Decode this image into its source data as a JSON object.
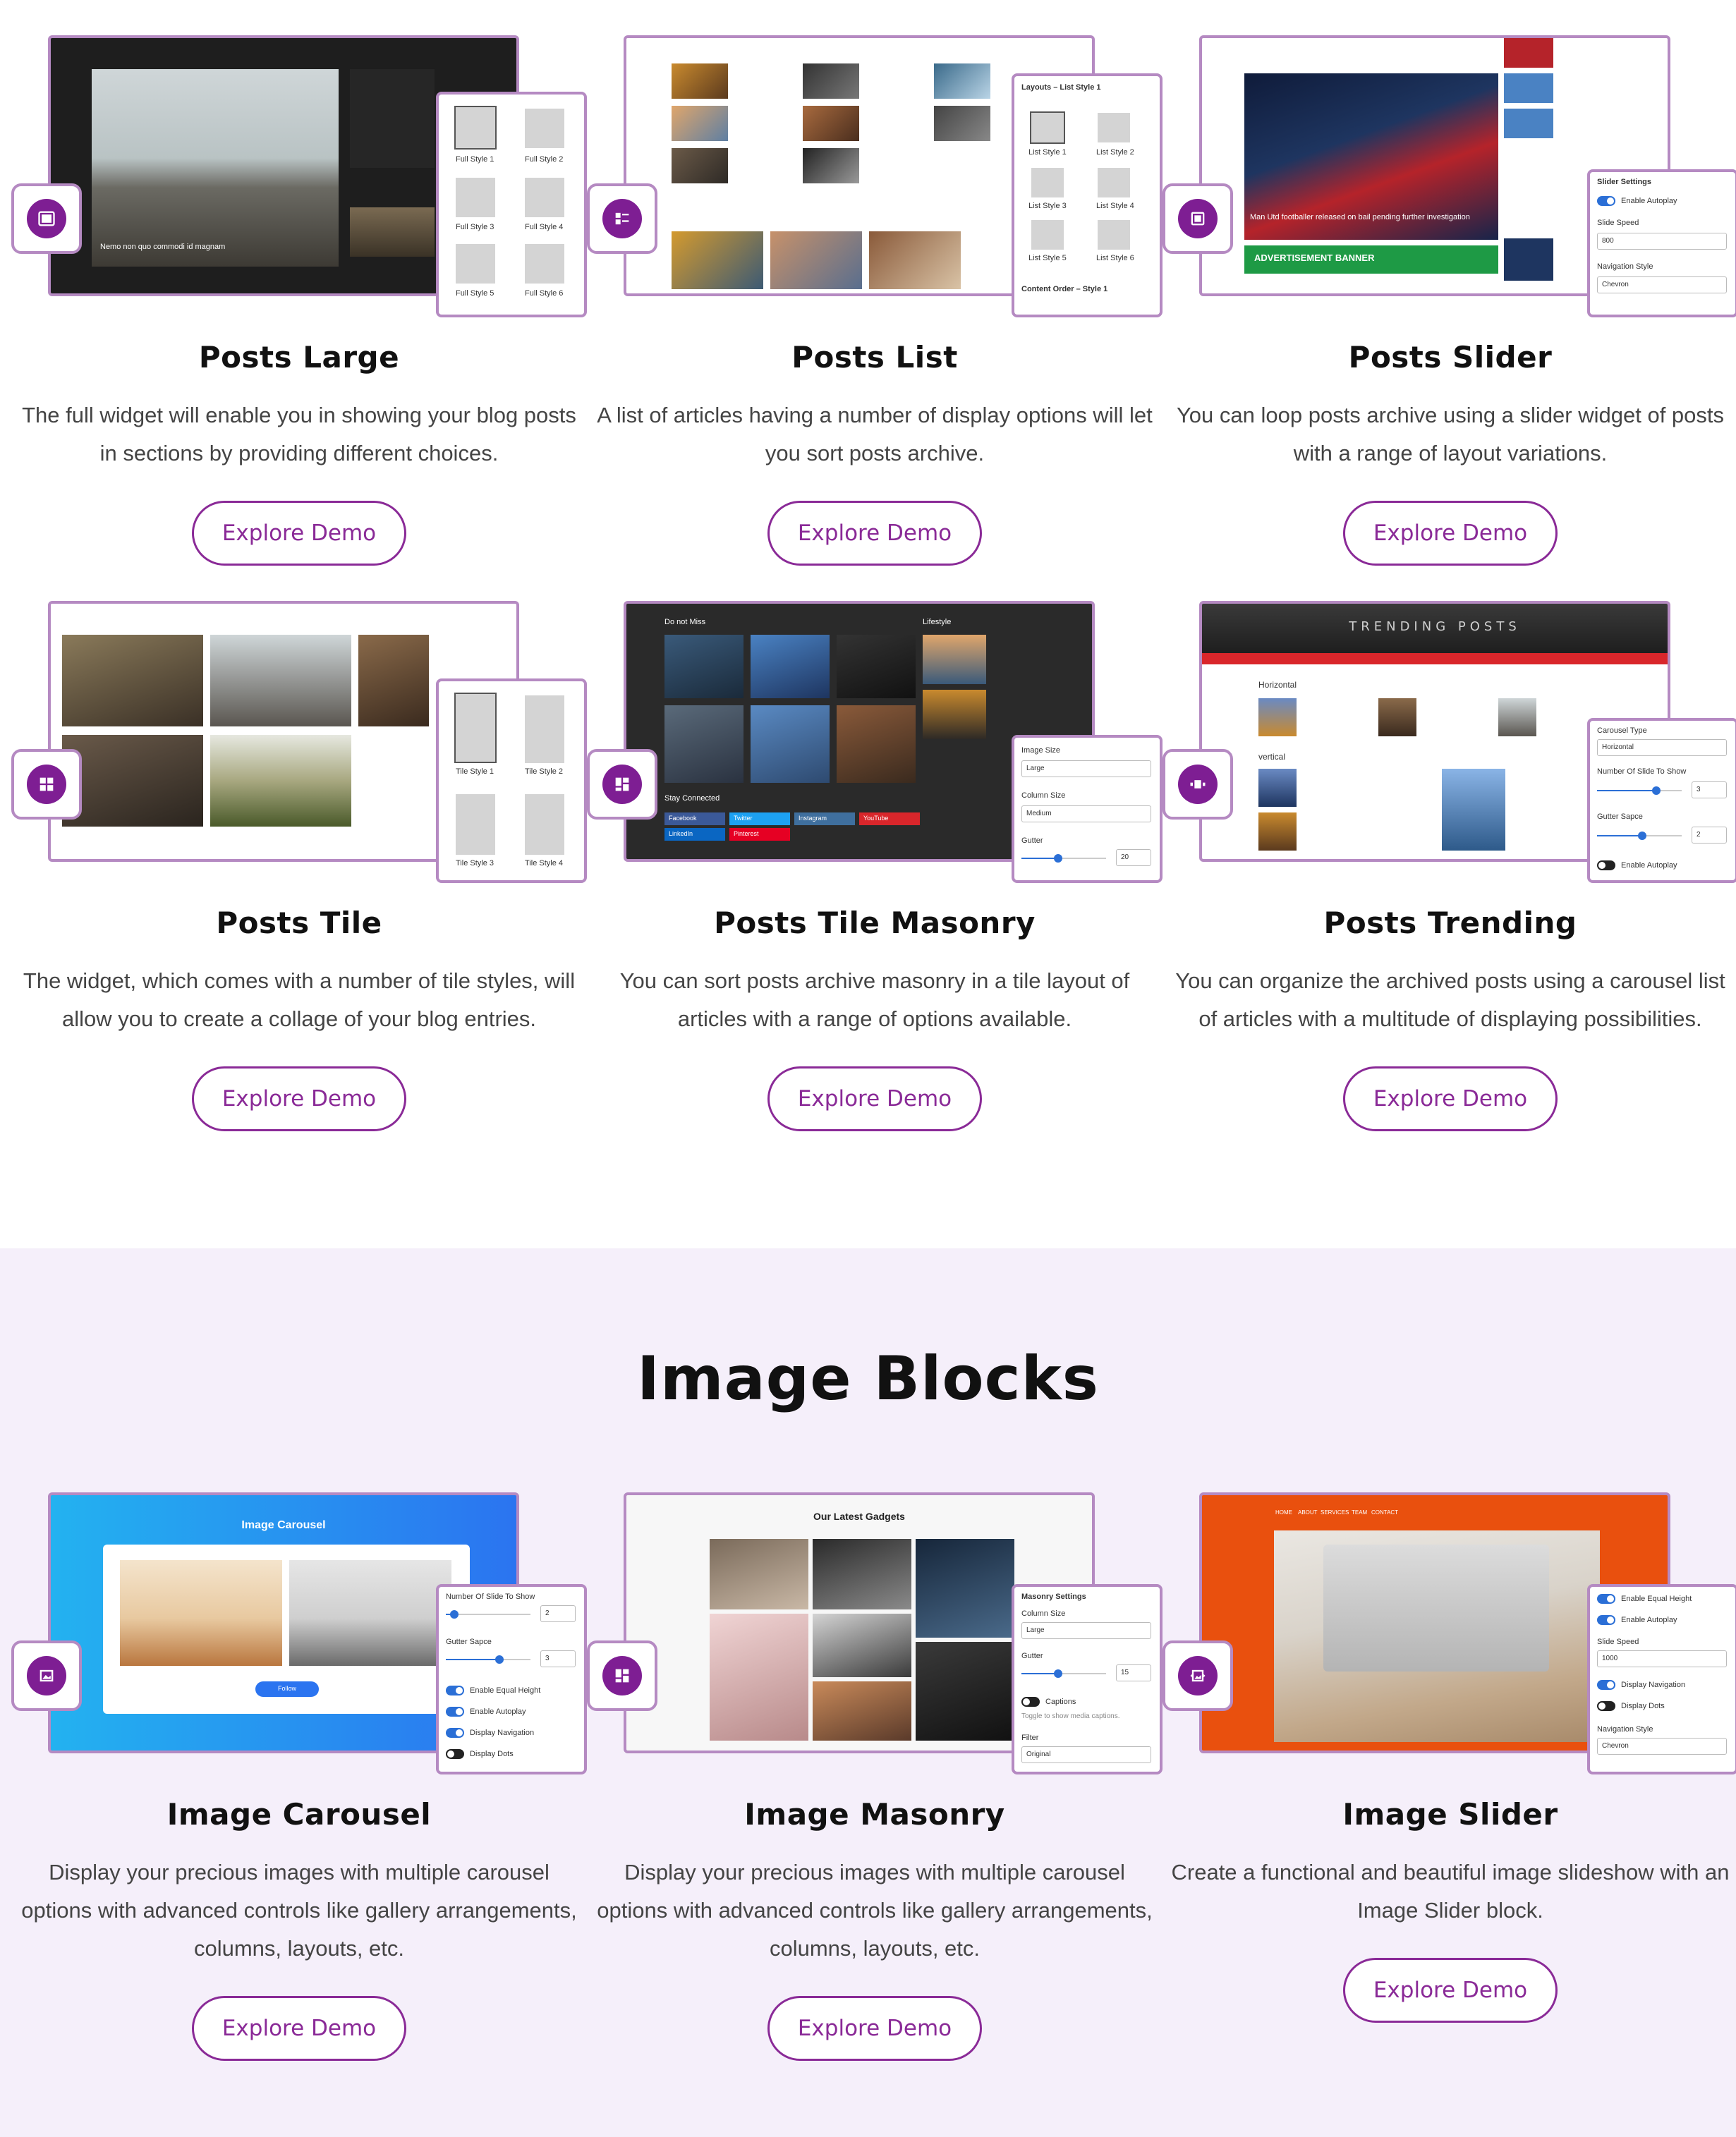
{
  "posts_blocks": [
    {
      "title": "Posts Large",
      "description": "The full widget will enable you in showing your blog posts in sections by providing different choices.",
      "button": "Explore Demo",
      "preview_caption": "Nemo non quo commodi id magnam",
      "panel_items": [
        "Full Style 1",
        "Full Style 2",
        "Full Style 3",
        "Full Style 4",
        "Full Style 5",
        "Full Style 6"
      ]
    },
    {
      "title": "Posts List",
      "description": "A list of articles having a number of display options will let you sort posts archive.",
      "button": "Explore Demo",
      "panel_heading": "Layouts – List Style 1",
      "panel_items": [
        "List Style 1",
        "List Style 2",
        "List Style 3",
        "List Style 4",
        "List Style 5",
        "List Style 6"
      ],
      "panel_footer": "Content Order – Style 1"
    },
    {
      "title": "Posts Slider",
      "description": "You can loop posts archive using a slider widget of posts with a range of layout variations.",
      "button": "Explore Demo",
      "preview_caption": "Man Utd footballer released on bail pending further investigation",
      "banner": "ADVERTISEMENT BANNER",
      "panel_heading": "Slider Settings",
      "panel_toggle": "Enable Autoplay",
      "panel_speed_label": "Slide Speed",
      "panel_speed": "800",
      "panel_nav_label": "Navigation Style",
      "panel_nav": "Chevron"
    },
    {
      "title": "Posts Tile",
      "description": "The widget, which comes with a number of tile styles, will allow you to create a collage of your blog entries.",
      "button": "Explore Demo",
      "panel_items": [
        "Tile Style 1",
        "Tile Style 2",
        "Tile Style 3",
        "Tile Style 4"
      ]
    },
    {
      "title": "Posts Tile Masonry",
      "description": "You can sort posts archive masonry in a tile layout of articles with a range of options available.",
      "button": "Explore Demo",
      "preview_left": "Do not Miss",
      "preview_right": "Lifestyle",
      "preview_footer": "Stay Connected",
      "social": [
        "Facebook",
        "Twitter",
        "Instagram",
        "YouTube",
        "LinkedIn",
        "Pinterest"
      ],
      "panel_size_label": "Image Size",
      "panel_size": "Large",
      "panel_col_label": "Column Size",
      "panel_col": "Medium",
      "panel_gutter_label": "Gutter",
      "panel_gutter": "20"
    },
    {
      "title": "Posts Trending",
      "description": "You can organize the archived posts using a carousel list of articles with a multitude of displaying possibilities.",
      "button": "Explore Demo",
      "preview_banner": "TRENDING POSTS",
      "preview_h1": "Horizontal",
      "preview_h2": "vertical",
      "panel_type_label": "Carousel Type",
      "panel_type": "Horizontal",
      "panel_show_label": "Number Of Slide To Show",
      "panel_show": "3",
      "panel_gutter_label": "Gutter Sapce",
      "panel_gutter": "2",
      "panel_toggle": "Enable Autoplay"
    }
  ],
  "image_section": {
    "heading": "Image Blocks"
  },
  "image_blocks": [
    {
      "title": "Image Carousel",
      "description": "Display your precious images with multiple carousel options with advanced controls like gallery arrangements, columns, layouts, etc.",
      "button": "Explore Demo",
      "preview_heading": "Image Carousel",
      "preview_button": "Follow",
      "panel_show_label": "Number Of Slide To Show",
      "panel_show": "2",
      "panel_gutter_label": "Gutter Sapce",
      "panel_gutter": "3",
      "toggles": [
        "Enable Equal Height",
        "Enable Autoplay",
        "Display Navigation",
        "Display Dots"
      ]
    },
    {
      "title": "Image Masonry",
      "description": "Display your precious images with multiple carousel options with advanced controls like gallery arrangements, columns, layouts, etc.",
      "button": "Explore Demo",
      "preview_heading": "Our Latest Gadgets",
      "panel_heading": "Masonry Settings",
      "panel_col_label": "Column Size",
      "panel_col": "Large",
      "panel_gutter_label": "Gutter",
      "panel_gutter": "15",
      "panel_caption": "Captions",
      "panel_caption_note": "Toggle to show media captions.",
      "panel_filter_label": "Filter",
      "panel_filter": "Original"
    },
    {
      "title": "Image Slider",
      "description": "Create a functional and beautiful image slideshow with an Image Slider block.",
      "button": "Explore Demo",
      "nav": [
        "HOME",
        "ABOUT",
        "SERVICES",
        "TEAM",
        "CONTACT"
      ],
      "toggles": [
        "Enable Equal Height",
        "Enable Autoplay"
      ],
      "panel_speed_label": "Slide Speed",
      "panel_speed": "1000",
      "toggles2": [
        "Display Navigation",
        "Display Dots"
      ],
      "panel_nav_label": "Navigation Style",
      "panel_nav": "Chevron"
    }
  ],
  "colors": {
    "accent": "#8a2a97",
    "border": "#b58ac2",
    "section_bg": "#f5effa"
  }
}
